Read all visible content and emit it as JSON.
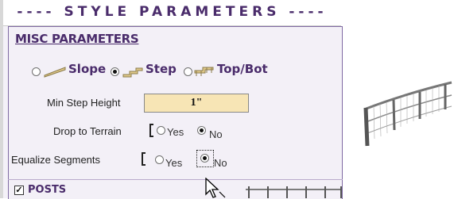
{
  "panel": {
    "title": "STYLE PARAMETERS",
    "section_title": "MISC PARAMETERS",
    "type_options": [
      {
        "label": "Slope",
        "selected": false,
        "icon": "slope-railing-icon"
      },
      {
        "label": "Step",
        "selected": true,
        "icon": "step-railing-icon"
      },
      {
        "label": "Top/Bot",
        "selected": false,
        "icon": "topbot-railing-icon"
      }
    ],
    "min_step_height": {
      "label": "Min Step Height",
      "value": "1\""
    },
    "drop_to_terrain": {
      "label": "Drop to Terrain",
      "yes": "Yes",
      "no": "No",
      "selected": "No"
    },
    "equalize_segments": {
      "label": "Equalize Segments",
      "yes": "Yes",
      "no": "No",
      "selected": "No"
    },
    "posts": {
      "label": "POSTS",
      "checked": true
    }
  },
  "colors": {
    "accent": "#4a2c6b",
    "input_bg": "#f7e5b5",
    "panel_bg": "#f3f0f7"
  }
}
